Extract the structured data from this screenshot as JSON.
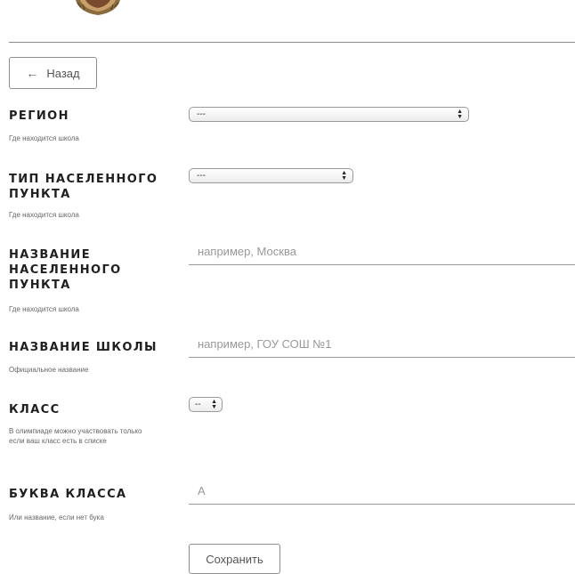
{
  "header": {
    "logo_icon": "emblem-icon"
  },
  "back_button": {
    "label": "Назад",
    "icon": "arrow-left-icon"
  },
  "fields": {
    "region": {
      "label": "Регион",
      "hint": "Где находится школа",
      "selected": "---",
      "control_icon": "updown-arrows-icon"
    },
    "settlement_type": {
      "label": "Тип населенного пункта",
      "hint": "Где находится школа",
      "selected": "---",
      "control_icon": "updown-arrows-icon"
    },
    "settlement_name": {
      "label": "Название населенного пункта",
      "hint": "Где находится школа",
      "value": "",
      "placeholder": "например, Москва"
    },
    "school_name": {
      "label": "Название школы",
      "hint": "Официальное название",
      "value": "",
      "placeholder": "например, ГОУ СОШ №1"
    },
    "grade": {
      "label": "Класс",
      "hint": "В олимпиаде можно участвовать только если ваш класс есть в списке",
      "selected": "--",
      "control_icon": "updown-arrows-icon"
    },
    "grade_letter": {
      "label": "Буква класса",
      "hint": "Или название, если нет бука",
      "value": "",
      "placeholder": "А"
    }
  },
  "save_button": {
    "label": "Сохранить"
  },
  "colors": {
    "divider": "#8a8a8a",
    "label": "#1f1f1f",
    "hint": "#666666",
    "placeholder": "#999999"
  }
}
